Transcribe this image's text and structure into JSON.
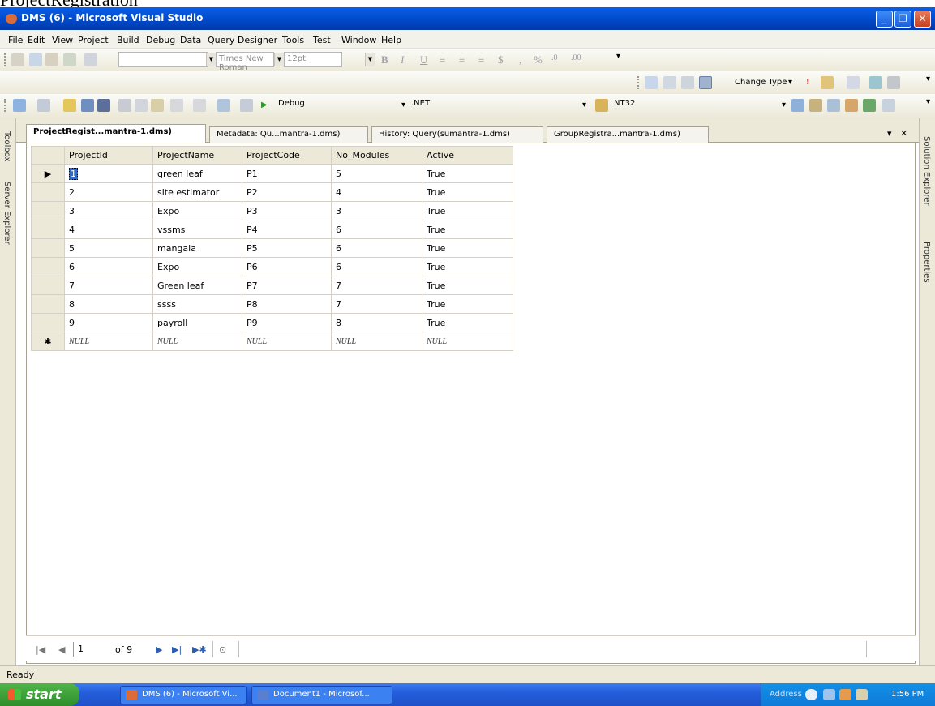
{
  "document_heading": "ProjectRegistration",
  "window": {
    "title": "DMS (6) - Microsoft Visual Studio",
    "controls": [
      "minimize",
      "maximize",
      "close"
    ]
  },
  "menu": [
    "File",
    "Edit",
    "View",
    "Project",
    "Build",
    "Debug",
    "Data",
    "Query Designer",
    "Tools",
    "Test",
    "Window",
    "Help"
  ],
  "format_toolbar": {
    "font_name": "Times New Roman",
    "font_size": "12pt"
  },
  "designer_toolbar": {
    "change_type_label": "Change Type"
  },
  "standard_toolbar": {
    "configuration": "Debug",
    "platform": ".NET",
    "find_value": "NT32"
  },
  "doc_tabs": [
    {
      "label": "ProjectRegist...mantra-1.dms)",
      "active": true
    },
    {
      "label": "Metadata: Qu...mantra-1.dms)",
      "active": false
    },
    {
      "label": "History: Query(sumantra-1.dms)",
      "active": false
    },
    {
      "label": "GroupRegistra...mantra-1.dms)",
      "active": false
    }
  ],
  "side_panels": {
    "left": [
      "Toolbox",
      "Server Explorer"
    ],
    "right": [
      "Solution Explorer",
      "Properties"
    ]
  },
  "grid": {
    "columns": [
      "ProjectId",
      "ProjectName",
      "ProjectCode",
      "No_Modules",
      "Active"
    ],
    "rows": [
      [
        "1",
        "green leaf",
        "P1",
        "5",
        "True"
      ],
      [
        "2",
        "site estimator",
        "P2",
        "4",
        "True"
      ],
      [
        "3",
        "Expo",
        "P3",
        "3",
        "True"
      ],
      [
        "4",
        "vssms",
        "P4",
        "6",
        "True"
      ],
      [
        "5",
        "mangala",
        "P5",
        "6",
        "True"
      ],
      [
        "6",
        "Expo",
        "P6",
        "6",
        "True"
      ],
      [
        "7",
        "Green leaf",
        "P7",
        "7",
        "True"
      ],
      [
        "8",
        "ssss",
        "P8",
        "7",
        "True"
      ],
      [
        "9",
        "payroll",
        "P9",
        "8",
        "True"
      ]
    ],
    "new_row": [
      "NULL",
      "NULL",
      "NULL",
      "NULL",
      "NULL"
    ]
  },
  "navigator": {
    "current": "1",
    "of_label": "of 9"
  },
  "status": "Ready",
  "taskbar": {
    "start_label": "start",
    "buttons": [
      "DMS (6) - Microsoft Vi...",
      "Document1 - Microsof..."
    ],
    "address_label": "Address",
    "clock": "1:56 PM"
  }
}
